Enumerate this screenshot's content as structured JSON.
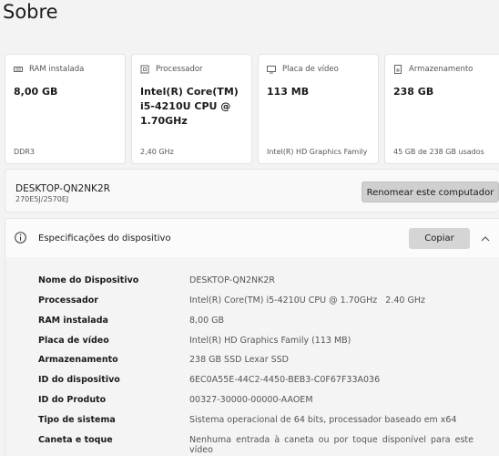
{
  "page_title": "Sobre",
  "cards": [
    {
      "icon": "ram-icon",
      "label": "RAM instalada",
      "value": "8,00 GB",
      "sub": "DDR3"
    },
    {
      "icon": "processor-icon",
      "label": "Processador",
      "value": "Intel(R) Core(TM) i5-4210U CPU @ 1.70GHz",
      "sub": "2,40 GHz"
    },
    {
      "icon": "display-icon",
      "label": "Placa de vídeo",
      "value": "113 MB",
      "sub": "Intel(R) HD Graphics Family"
    },
    {
      "icon": "storage-icon",
      "label": "Armazenamento",
      "value": "238 GB",
      "sub": "45 GB de 238 GB usados"
    }
  ],
  "device": {
    "name": "DESKTOP-QN2NK2R",
    "model": "270E5J/2570EJ",
    "rename_label": "Renomear este computador"
  },
  "specs": {
    "title": "Especificações do dispositivo",
    "copy_label": "Copiar",
    "rows": [
      {
        "label": "Nome do Dispositivo",
        "value": "DESKTOP-QN2NK2R"
      },
      {
        "label": "Processador",
        "value": "Intel(R) Core(TM) i5-4210U CPU @ 1.70GHz   2.40 GHz"
      },
      {
        "label": "RAM instalada",
        "value": "8,00 GB"
      },
      {
        "label": "Placa de vídeo",
        "value": "Intel(R) HD Graphics Family (113 MB)"
      },
      {
        "label": "Armazenamento",
        "value": "238 GB SSD Lexar SSD"
      },
      {
        "label": "ID do dispositivo",
        "value": "6EC0A55E-44C2-4450-BEB3-C0F67F33A036"
      },
      {
        "label": "ID do Produto",
        "value": "00327-30000-00000-AAOEM"
      },
      {
        "label": "Tipo de sistema",
        "value": "Sistema operacional de 64 bits, processador baseado em x64"
      },
      {
        "label": "Caneta e toque",
        "value": "Nenhuma entrada à caneta ou por toque disponível para este vídeo"
      }
    ]
  }
}
